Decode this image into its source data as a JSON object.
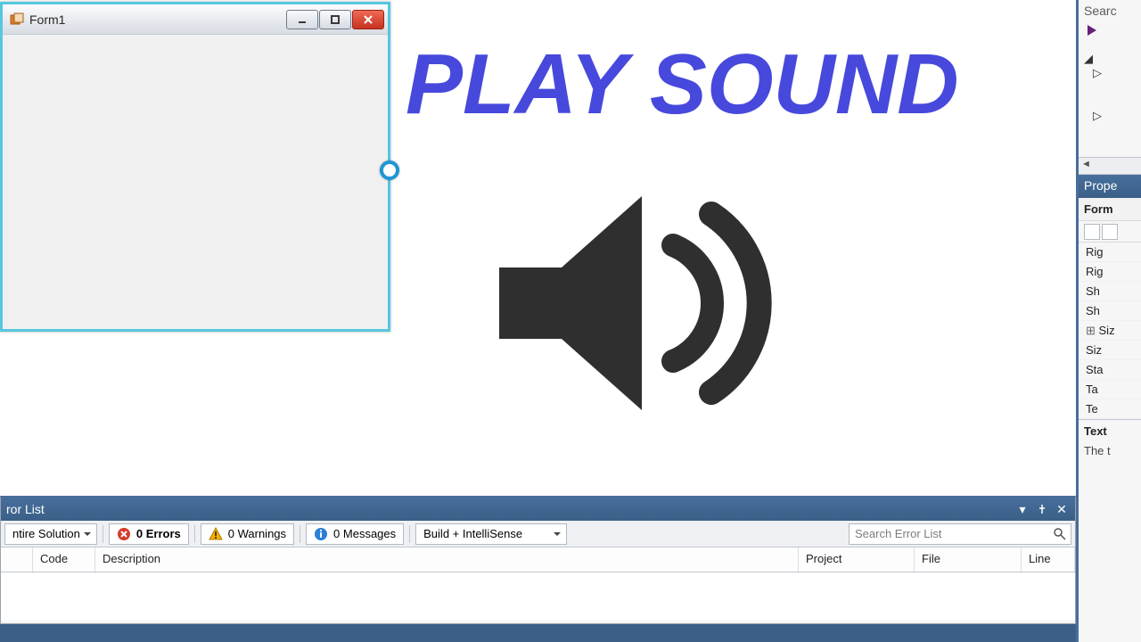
{
  "headline": "PLAY SOUND",
  "form": {
    "title": "Form1"
  },
  "error_panel": {
    "title": "ror List",
    "scope": "ntire Solution",
    "errors": "0 Errors",
    "warnings": "0 Warnings",
    "messages": "0 Messages",
    "filter_mode": "Build + IntelliSense",
    "search_placeholder": "Search Error List",
    "columns": {
      "code": "Code",
      "description": "Description",
      "project": "Project",
      "file": "File",
      "line": "Line"
    }
  },
  "right": {
    "search": "Searc",
    "prop_title": "Prope",
    "prop_object": "Form",
    "rows": [
      "Rig",
      "Rig",
      "Sh",
      "Sh",
      "Siz",
      "Siz",
      "Sta",
      "Ta",
      "Te"
    ],
    "desc_title": "Text",
    "desc_body": "The t"
  }
}
